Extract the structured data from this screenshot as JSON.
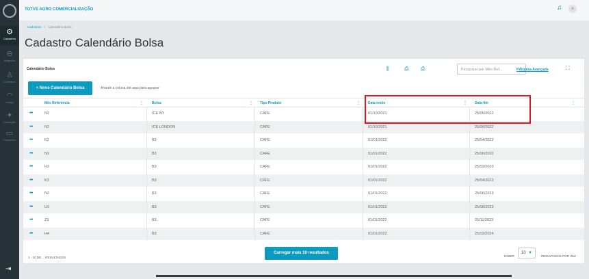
{
  "app": {
    "title": "TOTVS AGRO COMERCIALIZAÇÃO"
  },
  "sidebar": {
    "items": [
      {
        "label": "Cadastros",
        "icon": "gear-icon",
        "active": true
      },
      {
        "label": "Negócios",
        "icon": "handshake-icon",
        "active": false
      },
      {
        "label": "Contratos",
        "icon": "user-icon",
        "active": false
      },
      {
        "label": "Hedge",
        "icon": "wifi-icon",
        "active": false
      },
      {
        "label": "Execução",
        "icon": "running-icon",
        "active": false
      },
      {
        "label": "Financeiro",
        "icon": "money-icon",
        "active": false
      }
    ]
  },
  "breadcrumb": {
    "root": "Cadastros",
    "separator": "/",
    "current": "Calendário Bolsa"
  },
  "page": {
    "title": "Cadastro Calendário Bolsa"
  },
  "card": {
    "title": "Calendário Bolsa"
  },
  "toolbar": {
    "search_placeholder": "Pesquisar por Mês Ref...",
    "advanced_search": "Pesquisa Avançada",
    "new_button": "+ Novo Calendário Bolsa",
    "drag_hint": "Arraste a coluna até aqui para agrupar"
  },
  "table": {
    "columns": [
      "Mês Referência",
      "Bolsa",
      "Tipo Produto",
      "Data início",
      "Data fim"
    ],
    "rows": [
      [
        "N2",
        "ICE NY",
        "CAFE",
        "01/10/2021",
        "25/06/2022"
      ],
      [
        "N2",
        "ICE LONDON",
        "CAFE",
        "01/10/2021",
        "25/06/2022"
      ],
      [
        "K2",
        "B3",
        "CAFE",
        "01/01/2022",
        "25/04/2022"
      ],
      [
        "N2",
        "B3",
        "CAFE",
        "01/01/2022",
        "25/06/2022"
      ],
      [
        "H3",
        "B3",
        "CAFE",
        "01/01/2022",
        "25/02/2023"
      ],
      [
        "K3",
        "B3",
        "CAFE",
        "01/01/2022",
        "25/04/2023"
      ],
      [
        "N3",
        "B3",
        "CAFE",
        "01/01/2022",
        "25/06/2023"
      ],
      [
        "U3",
        "B3",
        "CAFE",
        "01/01/2022",
        "25/08/2023"
      ],
      [
        "Z3",
        "B3",
        "CAFE",
        "01/01/2022",
        "25/11/2023"
      ],
      [
        "H4",
        "B3",
        "CAFE",
        "01/01/2022",
        "25/02/2024"
      ]
    ]
  },
  "footer": {
    "results": "1 - 10 DE ... RESULTADOS",
    "load_more": "Carregar mais 10 resultados",
    "show_label": "EXIBIR",
    "page_size": "10",
    "per_page_label": "RESULTADOS POR VEZ"
  }
}
